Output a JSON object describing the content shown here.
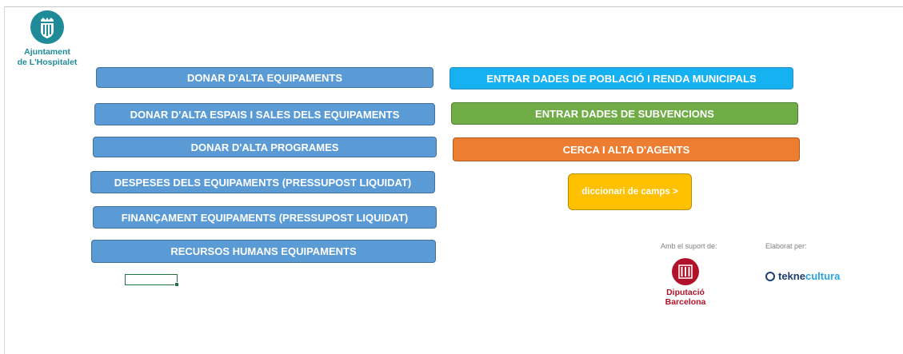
{
  "logo": {
    "line1": "Ajuntament",
    "line2": "de L'Hospitalet",
    "icon": "hospitalet-shield-icon",
    "color": "#1f8a98"
  },
  "left_buttons": [
    {
      "label": "DONAR D'ALTA EQUIPAMENTS"
    },
    {
      "label": "DONAR D'ALTA ESPAIS I SALES DELS EQUIPAMENTS"
    },
    {
      "label": "DONAR D'ALTA PROGRAMES"
    },
    {
      "label": "DESPESES DELS EQUIPAMENTS (PRESSUPOST LIQUIDAT)"
    },
    {
      "label": "FINANÇAMENT  EQUIPAMENTS (PRESSUPOST LIQUIDAT)"
    },
    {
      "label": "RECURSOS HUMANS EQUIPAMENTS"
    }
  ],
  "right_buttons": [
    {
      "label": "ENTRAR DADES DE POBLACIÓ I RENDA MUNICIPALS",
      "color": "#15b1f0"
    },
    {
      "label": "ENTRAR DADES DE SUBVENCIONS",
      "color": "#70ad47"
    },
    {
      "label": "CERCA I ALTA D'AGENTS",
      "color": "#ed7d31"
    }
  ],
  "dictionary_button": {
    "label": "diccionari de camps >",
    "color": "#ffc000"
  },
  "support": {
    "label": "Amb el suport de:",
    "org_line1": "Diputació",
    "org_line2": "Barcelona",
    "icon": "diputacio-emblem-icon",
    "color": "#b0122b"
  },
  "made_by": {
    "label": "Elaborat per:",
    "brand_a": "tekne",
    "brand_b": "cultura",
    "icon": "tekne-ring-icon"
  },
  "colors": {
    "primary_blue": "#5b9bd5",
    "excel_selection": "#217346"
  }
}
